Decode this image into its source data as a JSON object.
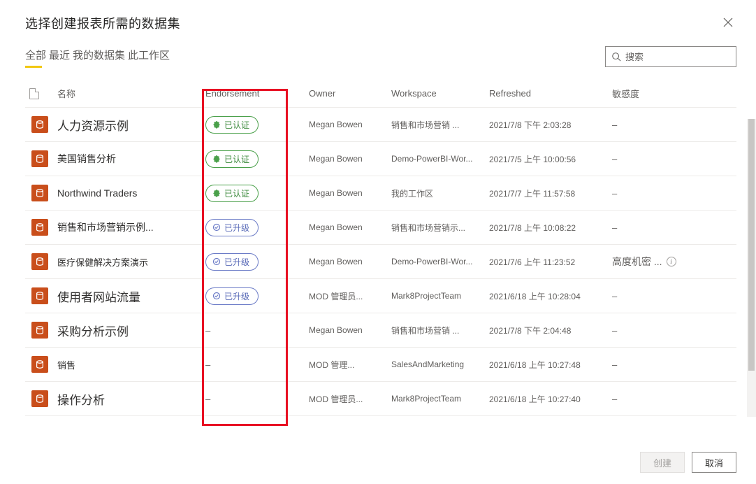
{
  "dialog": {
    "title": "选择创建报表所需的数据集",
    "tabs": [
      "全部",
      "最近",
      "我的数据集",
      "此工作区"
    ],
    "active_tab_index": 0,
    "search_placeholder": "搜索"
  },
  "columns": {
    "name": "名称",
    "endorsement": "Endorsement",
    "owner": "Owner",
    "workspace": "Workspace",
    "refreshed": "Refreshed",
    "sensitivity": "敏感度"
  },
  "badges": {
    "certified": "已认证",
    "promoted": "已升级"
  },
  "rows": [
    {
      "name": "人力资源示例",
      "name_size": "big",
      "endorsement": "certified",
      "owner": "Megan Bowen",
      "workspace": "销售和市场营销 ...",
      "refreshed": "2021/7/8 下午 2:03:28",
      "sensitivity": "–"
    },
    {
      "name": "美国销售分析",
      "name_size": "med",
      "endorsement": "certified",
      "owner": "Megan Bowen",
      "workspace": "Demo-PowerBI-Wor...",
      "refreshed": "2021/7/5 上午 10:00:56",
      "sensitivity": "–"
    },
    {
      "name": "Northwind Traders",
      "name_size": "med",
      "endorsement": "certified",
      "owner": "Megan  Bowen",
      "workspace": "我的工作区",
      "refreshed": "2021/7/7 上午 11:57:58",
      "sensitivity": "–"
    },
    {
      "name": "销售和市场营销示例...",
      "name_size": "med",
      "endorsement": "promoted",
      "owner": "Megan  Bowen",
      "workspace": "销售和市场营销示...",
      "refreshed": "2021/7/8 上午 10:08:22",
      "sensitivity": "–"
    },
    {
      "name": "医疗保健解决方案演示",
      "name_size": "",
      "endorsement": "promoted",
      "owner": "Megan Bowen",
      "workspace": "Demo-PowerBI-Wor...",
      "refreshed": "2021/7/6 上午 11:23:52",
      "sensitivity": "高度机密 ...",
      "info": true
    },
    {
      "name": "使用者网站流量",
      "name_size": "big",
      "endorsement": "promoted",
      "owner": "MOD 管理员...",
      "workspace": "Mark8ProjectTeam",
      "refreshed": "2021/6/18 上午 10:28:04",
      "sensitivity": "–"
    },
    {
      "name": "采购分析示例",
      "name_size": "big",
      "endorsement": "–",
      "owner": "Megan Bowen",
      "workspace": "销售和市场营销 ...",
      "refreshed": "2021/7/8 下午 2:04:48",
      "sensitivity": "–"
    },
    {
      "name": "销售",
      "name_size": "",
      "endorsement": "–",
      "owner": "MOD 管理...",
      "workspace": "SalesAndMarketing",
      "refreshed": "2021/6/18 上午 10:27:48",
      "sensitivity": "–"
    },
    {
      "name": "操作分析",
      "name_size": "big",
      "endorsement": "–",
      "owner": "MOD 管理员...",
      "workspace": "Mark8ProjectTeam",
      "refreshed": "2021/6/18 上午 10:27:40",
      "sensitivity": "–"
    }
  ],
  "footer": {
    "create": "创建",
    "cancel": "取消"
  }
}
